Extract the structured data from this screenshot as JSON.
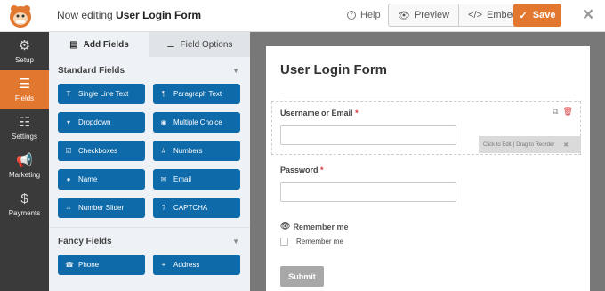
{
  "header": {
    "editing_prefix": "Now editing",
    "form_name": "User Login Form",
    "help_label": "Help",
    "preview_label": "Preview",
    "embed_label": "Embed",
    "save_label": "Save",
    "accent_color": "#e27730"
  },
  "nav": {
    "items": [
      {
        "label": "Setup",
        "icon": "gear-icon"
      },
      {
        "label": "Fields",
        "icon": "fields-list-icon",
        "active": true
      },
      {
        "label": "Settings",
        "icon": "sliders-icon"
      },
      {
        "label": "Marketing",
        "icon": "megaphone-icon"
      },
      {
        "label": "Payments",
        "icon": "dollar-icon"
      }
    ]
  },
  "panel": {
    "tabs": [
      {
        "label": "Add Fields",
        "active": true
      },
      {
        "label": "Field Options"
      }
    ],
    "standard": {
      "title": "Standard Fields",
      "fields": [
        {
          "label": "Single Line Text",
          "icon": "T"
        },
        {
          "label": "Paragraph Text",
          "icon": "¶"
        },
        {
          "label": "Dropdown",
          "icon": "▾"
        },
        {
          "label": "Multiple Choice",
          "icon": "◉"
        },
        {
          "label": "Checkboxes",
          "icon": "☑"
        },
        {
          "label": "Numbers",
          "icon": "#"
        },
        {
          "label": "Name",
          "icon": "👤"
        },
        {
          "label": "Email",
          "icon": "✉"
        },
        {
          "label": "Number Slider",
          "icon": "⇔"
        },
        {
          "label": "CAPTCHA",
          "icon": "?"
        }
      ]
    },
    "fancy": {
      "title": "Fancy Fields",
      "fields": [
        {
          "label": "Phone",
          "icon": "☎"
        },
        {
          "label": "Address",
          "icon": "⌖"
        }
      ]
    }
  },
  "form": {
    "title": "User Login Form",
    "username_label": "Username or Email",
    "password_label": "Password",
    "required_mark": "*",
    "edit_hint": "Click to Edit",
    "reorder_hint": "Drag to Reorder",
    "remember_heading": "Remember me",
    "remember_checkbox_label": "Remember me",
    "submit_label": "Submit"
  }
}
